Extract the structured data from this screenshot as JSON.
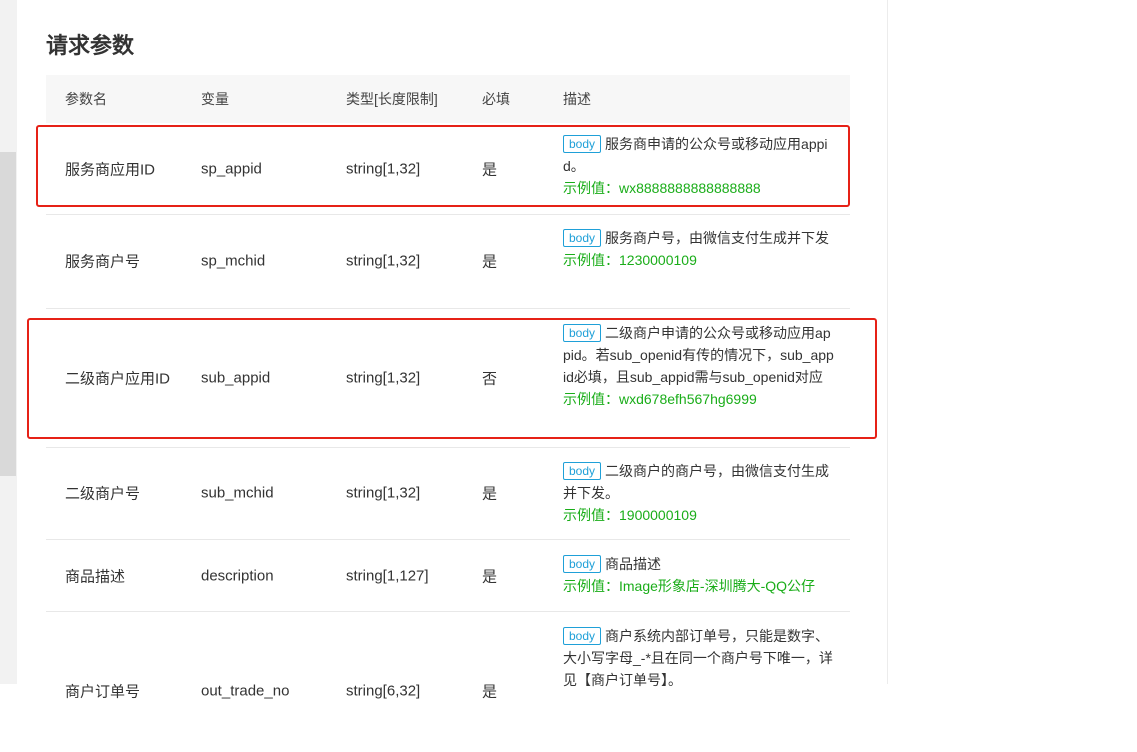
{
  "section": {
    "title": "请求参数"
  },
  "table": {
    "headers": [
      "参数名",
      "变量",
      "类型[长度限制]",
      "必填",
      "描述"
    ],
    "tag_label": "body",
    "rows": [
      {
        "name": "服务商应用ID",
        "var": "sp_appid",
        "type": "string[1,32]",
        "required": "是",
        "desc": "服务商申请的公众号或移动应用appid。",
        "example": "示例值：wx8888888888888888"
      },
      {
        "name": "服务商户号",
        "var": "sp_mchid",
        "type": "string[1,32]",
        "required": "是",
        "desc": "服务商户号，由微信支付生成并下发",
        "example": "示例值：1230000109"
      },
      {
        "name": "二级商户应用ID",
        "var": "sub_appid",
        "type": "string[1,32]",
        "required": "否",
        "desc": "二级商户申请的公众号或移动应用appid。若sub_openid有传的情况下，sub_appid必填，且sub_appid需与sub_openid对应",
        "example": "示例值：wxd678efh567hg6999"
      },
      {
        "name": "二级商户号",
        "var": "sub_mchid",
        "type": "string[1,32]",
        "required": "是",
        "desc": "二级商户的商户号，由微信支付生成并下发。",
        "example": "示例值：1900000109"
      },
      {
        "name": "商品描述",
        "var": "description",
        "type": "string[1,127]",
        "required": "是",
        "desc": "商品描述",
        "example": "示例值：Image形象店-深圳腾大-QQ公仔"
      },
      {
        "name": "商户订单号",
        "var": "out_trade_no",
        "type": "string[6,32]",
        "required": "是",
        "desc": "商户系统内部订单号，只能是数字、大小写字母_-*且在同一个商户号下唯一，详见【商户订单号】。",
        "example": ""
      }
    ]
  },
  "colors": {
    "highlight": "#e62117",
    "tag": "#1fa0d8",
    "example": "#1aad19"
  }
}
